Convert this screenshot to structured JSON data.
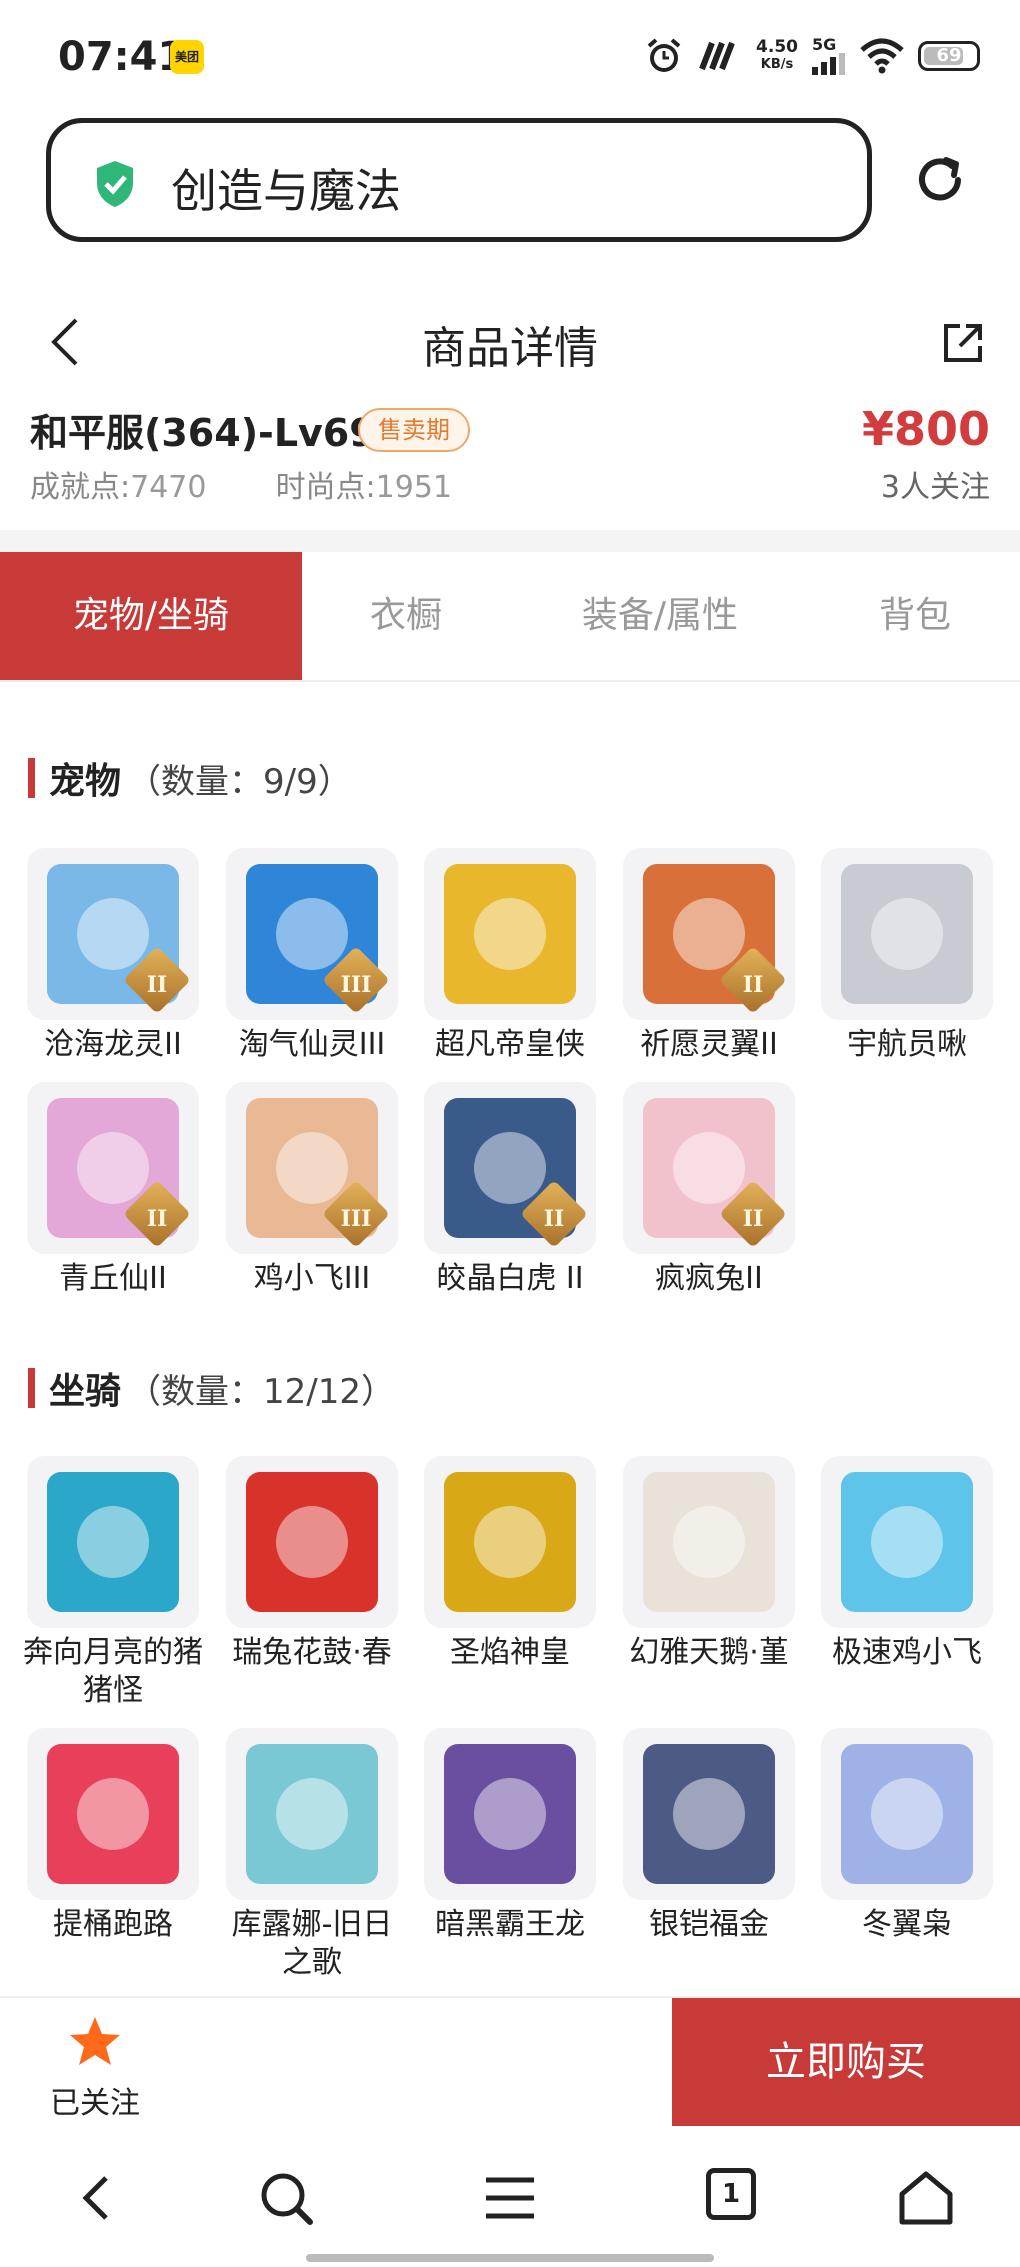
{
  "status_bar": {
    "time": "07:41",
    "app_badge": "美团",
    "net_speed_value": "4.50",
    "net_speed_unit": "KB/s",
    "network": "5G",
    "battery": "69"
  },
  "url_bar": {
    "text": "创造与魔法"
  },
  "header": {
    "title": "商品详情"
  },
  "product": {
    "name": "和平服(364)-Lv69",
    "tag": "售卖期",
    "achievement_label": "成就点:",
    "achievement_value": "7470",
    "fashion_label": "时尚点:",
    "fashion_value": "1951",
    "price": "¥800",
    "followers": "3人关注"
  },
  "tabs": [
    {
      "label": "宠物/坐骑",
      "active": true
    },
    {
      "label": "衣橱",
      "active": false
    },
    {
      "label": "装备/属性",
      "active": false
    },
    {
      "label": "背包",
      "active": false
    }
  ],
  "pets": {
    "title": "宠物",
    "count": "（数量：9/9）",
    "items": [
      {
        "name": "沧海龙灵II",
        "tier": "II",
        "color": "#7ab8e8"
      },
      {
        "name": "淘气仙灵III",
        "tier": "III",
        "color": "#2f86d8"
      },
      {
        "name": "超凡帝皇侠",
        "tier": "",
        "color": "#e8b72c"
      },
      {
        "name": "祈愿灵翼II",
        "tier": "II",
        "color": "#d9703a"
      },
      {
        "name": "宇航员啾",
        "tier": "",
        "color": "#c9cbd3"
      },
      {
        "name": "青丘仙II",
        "tier": "II",
        "color": "#e3a7d8"
      },
      {
        "name": "鸡小飞III",
        "tier": "III",
        "color": "#e9b996"
      },
      {
        "name": "皎晶白虎 II",
        "tier": "II",
        "color": "#3a5a8a"
      },
      {
        "name": "疯疯兔II",
        "tier": "II",
        "color": "#f2c2cc"
      }
    ]
  },
  "mounts": {
    "title": "坐骑",
    "count": "（数量：12/12）",
    "items": [
      {
        "name": "奔向月亮的猪猪怪",
        "color": "#2aa7c9"
      },
      {
        "name": "瑞兔花鼓·春",
        "color": "#d8322b"
      },
      {
        "name": "圣焰神皇",
        "color": "#d9a816"
      },
      {
        "name": "幻雅天鹅·堇",
        "color": "#e8e2d8"
      },
      {
        "name": "极速鸡小飞",
        "color": "#5ec4ea"
      },
      {
        "name": "提桶跑路",
        "color": "#e8405a"
      },
      {
        "name": "库露娜-旧日之歌",
        "color": "#79c8d4"
      },
      {
        "name": "暗黑霸王龙",
        "color": "#6a4ea0"
      },
      {
        "name": "银铠福金",
        "color": "#4d5a86"
      },
      {
        "name": "冬翼枭",
        "color": "#9fb2e8"
      }
    ]
  },
  "action_bar": {
    "follow_label": "已关注",
    "buy_label": "立即购买"
  },
  "browser_nav": {
    "tab_count": "1"
  },
  "colors": {
    "accent": "#c73a37",
    "price": "#d33c3c",
    "star": "#ff6a1a",
    "shield": "#2fb77a"
  }
}
